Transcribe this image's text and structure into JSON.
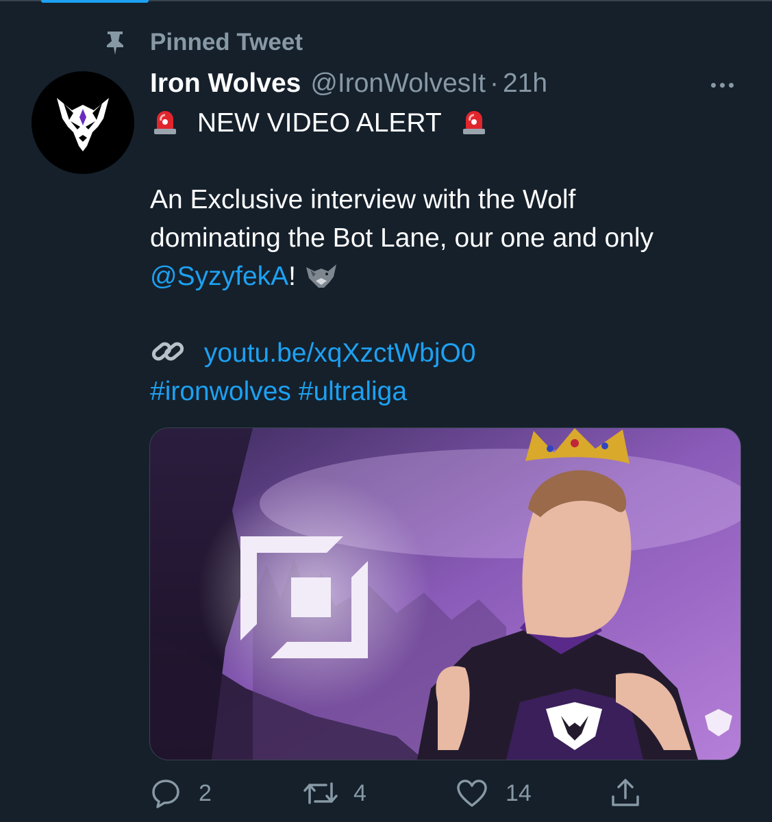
{
  "pinned": {
    "label": "Pinned Tweet",
    "icon": "pin-icon"
  },
  "author": {
    "display_name": "Iron Wolves",
    "handle": "@IronWolvesIt",
    "separator": "·",
    "time": "21h",
    "avatar_icon": "wolf-logo-icon"
  },
  "tweet": {
    "headline": "NEW VIDEO ALERT",
    "headline_emoji": "police-siren-icon",
    "line1": "An Exclusive interview with the Wolf",
    "line2": "dominating the Bot Lane, our one and only",
    "mention": "@SyzyfekA",
    "mention_suffix": "!",
    "wolf_emoji": "wolf-icon",
    "link_emoji": "link-icon",
    "url": "youtu.be/xqXzctWbjO0",
    "hashtag1": "#ironwolves",
    "hashtag2": "#ultraliga"
  },
  "media": {
    "alt_icon": "video-thumbnail"
  },
  "actions": {
    "replies": "2",
    "retweets": "4",
    "likes": "14",
    "reply_icon": "reply-icon",
    "retweet_icon": "retweet-icon",
    "like_icon": "heart-icon",
    "share_icon": "share-icon"
  },
  "colors": {
    "background": "#15202b",
    "secondary_text": "#8899a6",
    "link": "#1da1f2",
    "primary_text": "#ffffff"
  }
}
